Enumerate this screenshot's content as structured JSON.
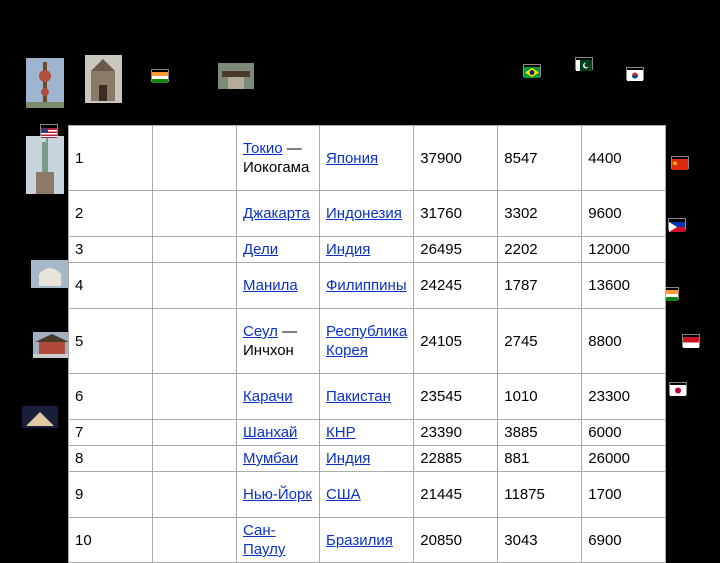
{
  "table": {
    "rows": [
      {
        "rank": "1",
        "city": "Токио — Иокогама",
        "city_link": "Токио",
        "city_rest": " — Иокогама",
        "country": "Япония",
        "population": "37900",
        "area": "8547",
        "density": "4400"
      },
      {
        "rank": "2",
        "city": "Джакарта",
        "city_link": "Джакарта",
        "city_rest": "",
        "country": "Индонезия",
        "population": "31760",
        "area": "3302",
        "density": "9600"
      },
      {
        "rank": "3",
        "city": "Дели",
        "city_link": "Дели",
        "city_rest": "",
        "country": "Индия",
        "population": "26495",
        "area": "2202",
        "density": "12000"
      },
      {
        "rank": "4",
        "city": "Манила",
        "city_link": "Манила",
        "city_rest": "",
        "country": "Филиппины",
        "population": "24245",
        "area": "1787",
        "density": "13600"
      },
      {
        "rank": "5",
        "city": "Сеул — Инчхон",
        "city_link": "Сеул",
        "city_rest": " — Инчхон",
        "country": "Республика Корея",
        "population": "24105",
        "area": "2745",
        "density": "8800"
      },
      {
        "rank": "6",
        "city": "Карачи",
        "city_link": "Карачи",
        "city_rest": "",
        "country": "Пакистан",
        "population": "23545",
        "area": "1010",
        "density": "23300"
      },
      {
        "rank": "7",
        "city": "Шанхай",
        "city_link": "Шанхай",
        "city_rest": "",
        "country": "КНР",
        "population": "23390",
        "area": "3885",
        "density": "6000"
      },
      {
        "rank": "8",
        "city": "Мумбаи",
        "city_link": "Мумбаи",
        "city_rest": "",
        "country": "Индия",
        "population": "22885",
        "area": "881",
        "density": "26000"
      },
      {
        "rank": "9",
        "city": "Нью-Йорк",
        "city_link": "Нью-Йорк",
        "city_rest": "",
        "country": "США",
        "population": "21445",
        "area": "11875",
        "density": "1700"
      },
      {
        "rank": "10",
        "city": "Сан-Паулу",
        "city_link": "Сан-Паулу",
        "city_rest": "",
        "country": "Бразилия",
        "population": "20850",
        "area": "3043",
        "density": "6900"
      }
    ]
  },
  "flags": [
    "india",
    "brazil",
    "pakistan",
    "south-korea",
    "usa",
    "china",
    "philippines",
    "india",
    "indonesia",
    "japan"
  ],
  "photos": [
    "shanghai-tower",
    "manila-cathedral",
    "seoul-gate",
    "statue-of-liberty",
    "karachi-mausoleum",
    "seoul-palace",
    "mumbai-gateway",
    "new-york-building"
  ],
  "colors": {
    "background": "#000000",
    "link": "#0b31c9",
    "cell_bg": "#ffffff"
  }
}
